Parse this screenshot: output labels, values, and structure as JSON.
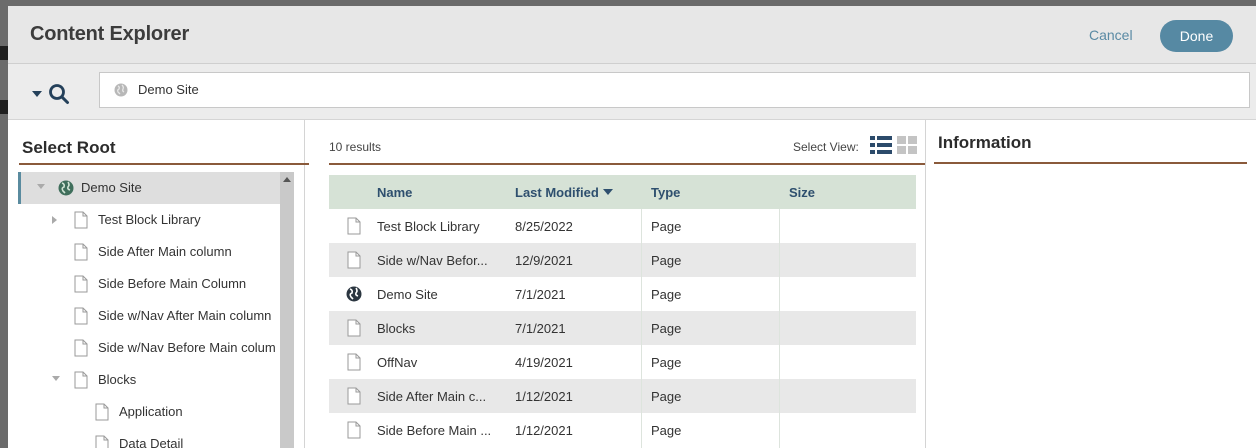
{
  "header": {
    "title": "Content Explorer",
    "cancel_label": "Cancel",
    "done_label": "Done"
  },
  "search": {
    "value": "Demo Site"
  },
  "left_panel": {
    "title": "Select Root",
    "tree": [
      {
        "label": "Demo Site",
        "icon": "globe-icon",
        "expander": "down"
      },
      {
        "label": "Test Block Library",
        "icon": "page-icon",
        "expander": "right"
      },
      {
        "label": "Side After Main column",
        "icon": "page-icon",
        "expander": ""
      },
      {
        "label": "Side Before Main Column",
        "icon": "page-icon",
        "expander": ""
      },
      {
        "label": "Side w/Nav After Main column",
        "icon": "page-icon",
        "expander": ""
      },
      {
        "label": "Side w/Nav Before Main colum",
        "icon": "page-icon",
        "expander": ""
      },
      {
        "label": "Blocks",
        "icon": "page-icon",
        "expander": "down"
      },
      {
        "label": "Application",
        "icon": "page-icon",
        "expander": ""
      },
      {
        "label": "Data Detail",
        "icon": "page-icon",
        "expander": ""
      }
    ]
  },
  "results": {
    "count_label": "10 results",
    "select_view_label": "Select View:",
    "columns": {
      "name": "Name",
      "modified": "Last Modified",
      "type": "Type",
      "size": "Size"
    },
    "rows": [
      {
        "icon": "page-icon",
        "name": "Test Block Library",
        "modified": "8/25/2022",
        "type": "Page",
        "size": ""
      },
      {
        "icon": "page-icon",
        "name": "Side w/Nav Befor...",
        "modified": "12/9/2021",
        "type": "Page",
        "size": ""
      },
      {
        "icon": "globe-icon",
        "name": "Demo Site",
        "modified": "7/1/2021",
        "type": "Page",
        "size": ""
      },
      {
        "icon": "page-icon",
        "name": "Blocks",
        "modified": "7/1/2021",
        "type": "Page",
        "size": ""
      },
      {
        "icon": "page-icon",
        "name": "OffNav",
        "modified": "4/19/2021",
        "type": "Page",
        "size": ""
      },
      {
        "icon": "page-icon",
        "name": "Side After Main c...",
        "modified": "1/12/2021",
        "type": "Page",
        "size": ""
      },
      {
        "icon": "page-icon",
        "name": "Side Before Main ...",
        "modified": "1/12/2021",
        "type": "Page",
        "size": ""
      }
    ]
  },
  "info_panel": {
    "title": "Information"
  },
  "colors": {
    "accent": "#5689a3",
    "rule": "#8a5a3b",
    "header_row": "#d6e2d6"
  }
}
